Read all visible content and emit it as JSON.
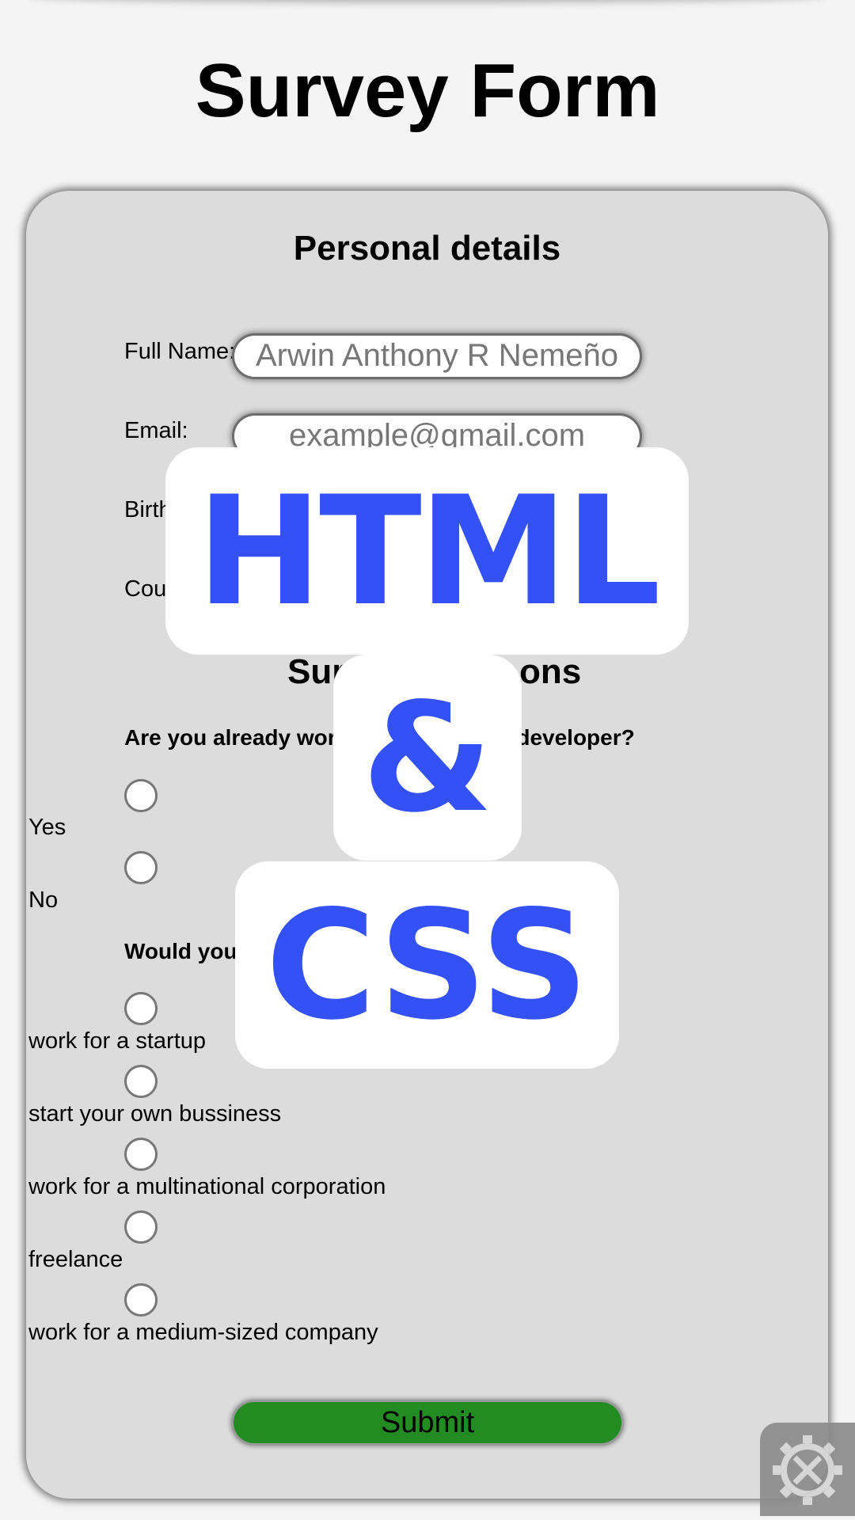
{
  "page_title": "Survey Form",
  "personal": {
    "heading": "Personal details",
    "full_name_label": "Full Name:",
    "full_name_value": "Arwin Anthony R  Nemeño",
    "email_label": "Email:",
    "email_placeholder": "example@gmail.com",
    "birth_label_visible": "Birth",
    "country_label_visible": "Cou"
  },
  "survey": {
    "heading_left": "Sur",
    "heading_right": "ons",
    "q1_left": "Are you already wor",
    "q1_right": "e developer?",
    "q1_options": [
      "Yes",
      "No"
    ],
    "q2_left": "Would you",
    "q2_options": [
      "work for a startup",
      "start your own bussiness",
      "work for a multinational corporation",
      "freelance",
      "work for a medium-sized company"
    ]
  },
  "submit_label": "Submit",
  "overlay": {
    "html_text": "HTML",
    "amp_text": "&",
    "css_text": "CSS",
    "color": "#3451f5"
  },
  "icons": {
    "settings": "settings-tools-icon"
  }
}
